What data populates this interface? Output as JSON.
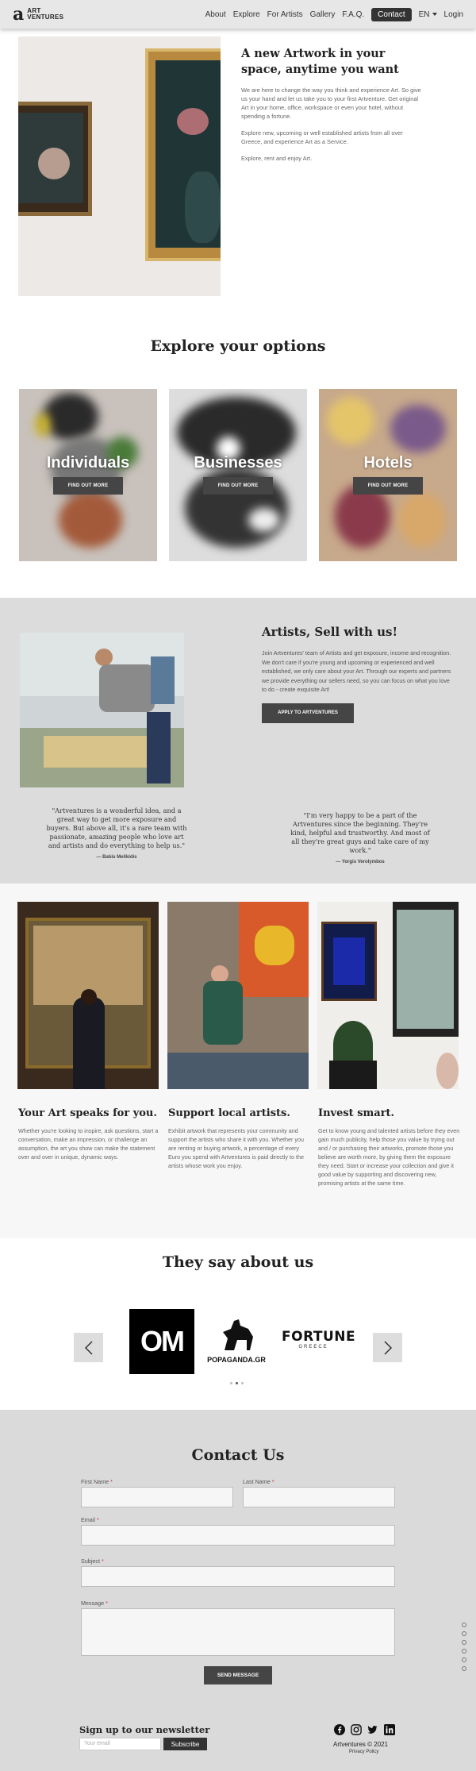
{
  "nav": {
    "brand_line1": "ART",
    "brand_line2": "VENTURES",
    "items": [
      "About",
      "Explore",
      "For Artists",
      "Gallery",
      "F.A.Q."
    ],
    "cta": "Contact",
    "language": "EN",
    "login": "Login"
  },
  "hero": {
    "title": "A new Artwork in your space, anytime you want",
    "p1": "We are here to change the way you think and experience Art. So give us your hand and let us take you to your first Artventure. Get original Art in your home, office, workspace or even your hotel, without spending a fortune.",
    "p2": "Explore new, upcoming or well established artists from all over Greece, and experience Art as a Service.",
    "p3": "Explore, rent and enjoy Art."
  },
  "options": {
    "title": "Explore your options",
    "cards": [
      {
        "label": "Individuals",
        "button": "FIND OUT MORE"
      },
      {
        "label": "Businesses",
        "button": "FIND OUT MORE"
      },
      {
        "label": "Hotels",
        "button": "FIND OUT MORE"
      }
    ]
  },
  "artists": {
    "title": "Artists, Sell with us!",
    "text": "Join Artventures' team of Artists and get exposure, income and recognition. We don't care if you're young and upcoming or experienced and well established, we only care about your Art. Through our experts and partners we provide everything our sellers need, so you can focus on what you love to do - create exquisite Art!",
    "button": "APPLY TO ARTVENTURES",
    "quotes": [
      {
        "text": "\"Artventures is a wonderful idea, and a great way to get more exposure and buyers. But above all, it's a rare team with passionate, amazing people who love art and artists and do everything to help us.\"",
        "author": "— Babis Melikidis"
      },
      {
        "text": "\"I'm very happy to be a part of the Artventures since the beginning. They're kind, helpful and trustworthy. And most of all they're great guys and take care of my work.\"",
        "author": "— Yorgis Verolymbos"
      }
    ]
  },
  "features": [
    {
      "title": "Your Art speaks for you.",
      "text": "Whether you're looking to inspire, ask questions, start a conversation, make an impression, or challenge an assumption, the art you show can make the statement over and over in unique, dynamic ways."
    },
    {
      "title": "Support local artists.",
      "text": "Exhibit artwork that represents your community and support the artists who share it with you. Whether you are renting or buying artwork, a percentage of every Euro you spend with Artventures is paid directly to the artists whose work you enjoy."
    },
    {
      "title": "Invest smart.",
      "text": "Get to know young and talented artists before they even gain much publicity, help those you value by trying out and / or purchasing their artworks, promote those you believe are worth more, by giving them the exposure they need. Start or increase your collection and give it good value by supporting and discovering new, promising artists at the same time."
    }
  ],
  "press": {
    "title": "They say about us",
    "logos": [
      {
        "name": "OM",
        "text": "OM"
      },
      {
        "name": "Popaganda",
        "text": "POPAGANDA.GR"
      },
      {
        "name": "Fortune Greece",
        "text": "FORTUNE",
        "sub": "GREECE"
      }
    ]
  },
  "contact": {
    "title": "Contact Us",
    "first_name": "First Name",
    "last_name": "Last Name",
    "email": "Email",
    "subject": "Subject",
    "message": "Message",
    "required_mark": "*",
    "button": "SEND MESSAGE"
  },
  "newsletter": {
    "title": "Sign up to our newsletter",
    "placeholder": "Your email",
    "button": "Subscribe"
  },
  "footer": {
    "copyright": "Artventures © 2021",
    "privacy": "Privacy Policy",
    "social_icons": [
      "facebook-icon",
      "instagram-icon",
      "twitter-icon",
      "linkedin-icon"
    ]
  }
}
